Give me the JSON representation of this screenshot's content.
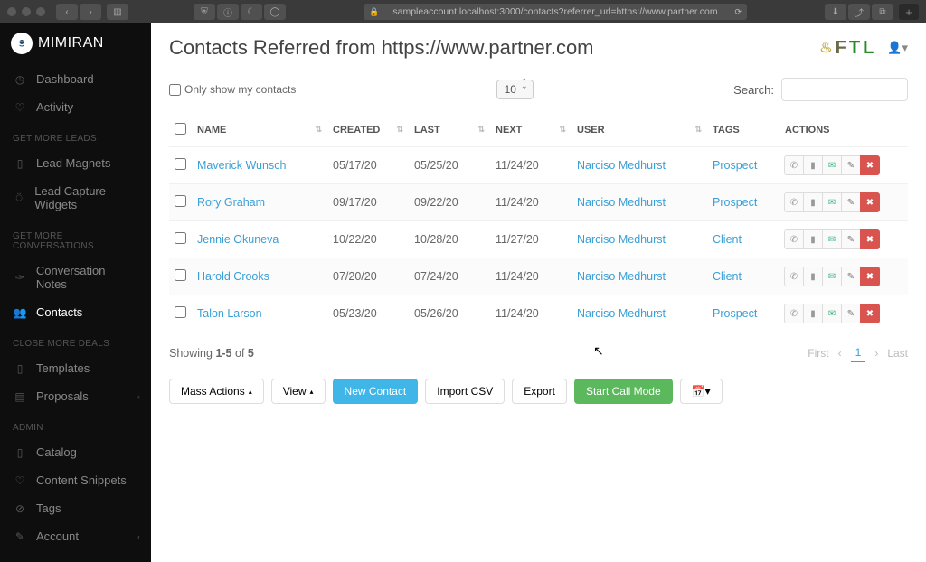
{
  "browser": {
    "url": "sampleaccount.localhost:3000/contacts?referrer_url=https://www.partner.com"
  },
  "brand": {
    "name": "MIMIRAN"
  },
  "sidebar": {
    "main": [
      {
        "label": "Dashboard",
        "icon": "tachometer"
      },
      {
        "label": "Activity",
        "icon": "heartbeat"
      }
    ],
    "sections": [
      {
        "title": "GET MORE LEADS",
        "items": [
          {
            "label": "Lead Magnets",
            "icon": "book"
          },
          {
            "label": "Lead Capture Widgets",
            "icon": "user-plus"
          }
        ]
      },
      {
        "title": "GET MORE CONVERSATIONS",
        "items": [
          {
            "label": "Conversation Notes",
            "icon": "comments"
          },
          {
            "label": "Contacts",
            "icon": "users",
            "active": true
          }
        ]
      },
      {
        "title": "CLOSE MORE DEALS",
        "items": [
          {
            "label": "Templates",
            "icon": "file"
          },
          {
            "label": "Proposals",
            "icon": "file-text",
            "caret": true
          }
        ]
      },
      {
        "title": "ADMIN",
        "items": [
          {
            "label": "Catalog",
            "icon": "file"
          },
          {
            "label": "Content Snippets",
            "icon": "heart"
          },
          {
            "label": "Tags",
            "icon": "tags"
          },
          {
            "label": "Account",
            "icon": "wrench",
            "caret": true
          }
        ]
      }
    ]
  },
  "header": {
    "title": "Contacts Referred from https://www.partner.com",
    "secondary_brand": "FTL"
  },
  "controls": {
    "only_my_label": "Only show my contacts",
    "page_size": "10",
    "search_label": "Search:"
  },
  "table": {
    "columns": {
      "name": "NAME",
      "created": "CREATED",
      "last": "LAST",
      "next": "NEXT",
      "user": "USER",
      "tags": "TAGS",
      "actions": "ACTIONS"
    },
    "rows": [
      {
        "name": "Maverick Wunsch",
        "created": "05/17/20",
        "last": "05/25/20",
        "next": "11/24/20",
        "user": "Narciso Medhurst",
        "tag": "Prospect"
      },
      {
        "name": "Rory Graham",
        "created": "09/17/20",
        "last": "09/22/20",
        "next": "11/24/20",
        "user": "Narciso Medhurst",
        "tag": "Prospect"
      },
      {
        "name": "Jennie Okuneva",
        "created": "10/22/20",
        "last": "10/28/20",
        "next": "11/27/20",
        "user": "Narciso Medhurst",
        "tag": "Client"
      },
      {
        "name": "Harold Crooks",
        "created": "07/20/20",
        "last": "07/24/20",
        "next": "11/24/20",
        "user": "Narciso Medhurst",
        "tag": "Client"
      },
      {
        "name": "Talon Larson",
        "created": "05/23/20",
        "last": "05/26/20",
        "next": "11/24/20",
        "user": "Narciso Medhurst",
        "tag": "Prospect"
      }
    ]
  },
  "footer": {
    "showing_prefix": "Showing ",
    "range": "1-5",
    "of": " of ",
    "total": "5",
    "first": "First",
    "last": "Last",
    "current_page": "1"
  },
  "buttons": {
    "mass_actions": "Mass Actions",
    "view": "View",
    "new_contact": "New Contact",
    "import_csv": "Import CSV",
    "export": "Export",
    "start_call": "Start Call Mode"
  }
}
